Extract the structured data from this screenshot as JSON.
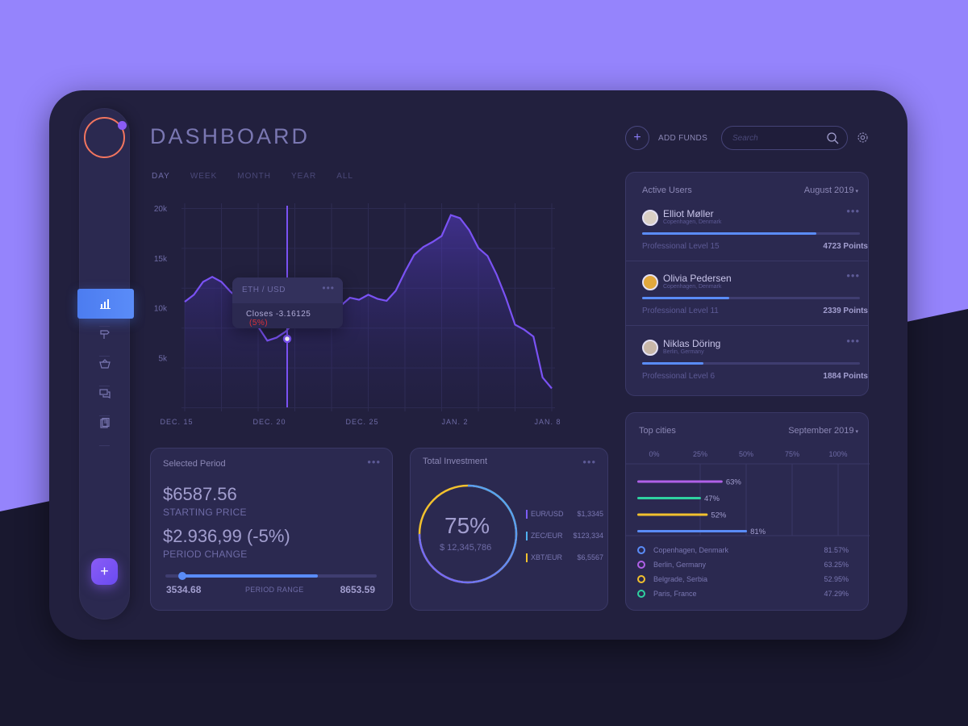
{
  "header": {
    "title": "DASHBOARD",
    "add_funds_icon": "+",
    "add_funds_label": "ADD FUNDS",
    "search_placeholder": "Search"
  },
  "tabs": [
    {
      "label": "DAY",
      "active": true
    },
    {
      "label": "WEEK",
      "active": false
    },
    {
      "label": "MONTH",
      "active": false
    },
    {
      "label": "YEAR",
      "active": false
    },
    {
      "label": "ALL",
      "active": false
    }
  ],
  "sidebar": {
    "items": [
      "bar-chart-icon",
      "signpost-icon",
      "basket-icon",
      "chat-icon",
      "clipboard-icon"
    ],
    "fab_label": "+"
  },
  "chart_data": {
    "type": "area",
    "x_tick_labels": [
      "DEC. 15",
      "DEC. 20",
      "DEC. 25",
      "JAN. 2",
      "JAN. 8"
    ],
    "y_tick_labels": [
      "20k",
      "15k",
      "10k",
      "5k"
    ],
    "ylim": [
      0,
      20000
    ],
    "x": [
      0,
      0.5,
      1,
      1.5,
      2,
      2.5,
      3,
      3.5,
      4,
      4.5,
      5,
      5.5,
      6,
      6.5,
      7,
      7.5,
      8,
      8.5,
      9,
      9.5,
      10,
      10.5,
      11,
      11.5,
      12,
      12.5,
      13,
      13.5,
      14,
      14.5,
      15,
      15.5,
      16,
      16.5,
      17,
      17.5,
      18,
      18.5,
      19,
      19.5,
      20
    ],
    "values": [
      10600,
      11300,
      12600,
      13100,
      12600,
      11600,
      10800,
      9500,
      8100,
      6700,
      7000,
      7600,
      8600,
      9300,
      9800,
      9600,
      10400,
      10200,
      11000,
      10800,
      11300,
      10900,
      10700,
      11700,
      13600,
      15300,
      16100,
      16600,
      17200,
      19300,
      19000,
      17800,
      16000,
      15200,
      13300,
      11000,
      8300,
      7800,
      7100,
      3000,
      1900
    ],
    "grid": true,
    "tooltip": {
      "header": "ETH / USD",
      "text": "Closes -3.16125",
      "change": "(5%)"
    }
  },
  "selected_period": {
    "title": "Selected Period",
    "starting_price": "$6587.56",
    "starting_label": "STARTING PRICE",
    "period_change": "$2.936,99 (-5%)",
    "change_label": "PERIOD CHANGE",
    "range_min": "3534.68",
    "range_label": "PERIOD RANGE",
    "range_max": "8653.59",
    "range_fill_start": 0.08,
    "range_fill_end": 0.72
  },
  "total_investment": {
    "title": "Total Investment",
    "percent": "75%",
    "amount": "$ 12,345,786",
    "pairs": [
      {
        "name": "EUR/USD",
        "value": "$1,3345",
        "color": "#7b5cf6"
      },
      {
        "name": "ZEC/EUR",
        "value": "$123,334",
        "color": "#4fb0f0"
      },
      {
        "name": "XBT/EUR",
        "value": "$6,5567",
        "color": "#f2c12e"
      }
    ]
  },
  "active_users": {
    "title": "Active Users",
    "period": "August 2019",
    "users": [
      {
        "name": "Elliot Møller",
        "location": "Copenhagen, Denmark",
        "level": "Professional Level 15",
        "points": "4723 Points",
        "progress": 0.8,
        "avatar_color": "#d9cfc4"
      },
      {
        "name": "Olivia Pedersen",
        "location": "Copenhagen, Denmark",
        "level": "Professional Level 11",
        "points": "2339 Points",
        "progress": 0.4,
        "avatar_color": "#e2a83c"
      },
      {
        "name": "Niklas Döring",
        "location": "Berlin, Germany",
        "level": "Professional Level 6",
        "points": "1884 Points",
        "progress": 0.28,
        "avatar_color": "#c8b7a8"
      }
    ]
  },
  "top_cities": {
    "title": "Top cities",
    "period": "September 2019",
    "axis": [
      "0%",
      "25%",
      "50%",
      "75%",
      "100%"
    ],
    "bars": [
      {
        "label": "63%",
        "value": 63,
        "color": "#b061e8"
      },
      {
        "label": "47%",
        "value": 47,
        "color": "#2fd1a0"
      },
      {
        "label": "52%",
        "value": 52,
        "color": "#f2c12e"
      },
      {
        "label": "81%",
        "value": 81,
        "color": "#5a8cf8"
      }
    ],
    "cities": [
      {
        "name": "Copenhagen, Denmark",
        "value": "81.57%",
        "color": "#5a8cf8"
      },
      {
        "name": "Berlin, Germany",
        "value": "63.25%",
        "color": "#b061e8"
      },
      {
        "name": "Belgrade, Serbia",
        "value": "52.95%",
        "color": "#f2c12e"
      },
      {
        "name": "Paris, France",
        "value": "47.29%",
        "color": "#2fd1a0"
      }
    ]
  }
}
